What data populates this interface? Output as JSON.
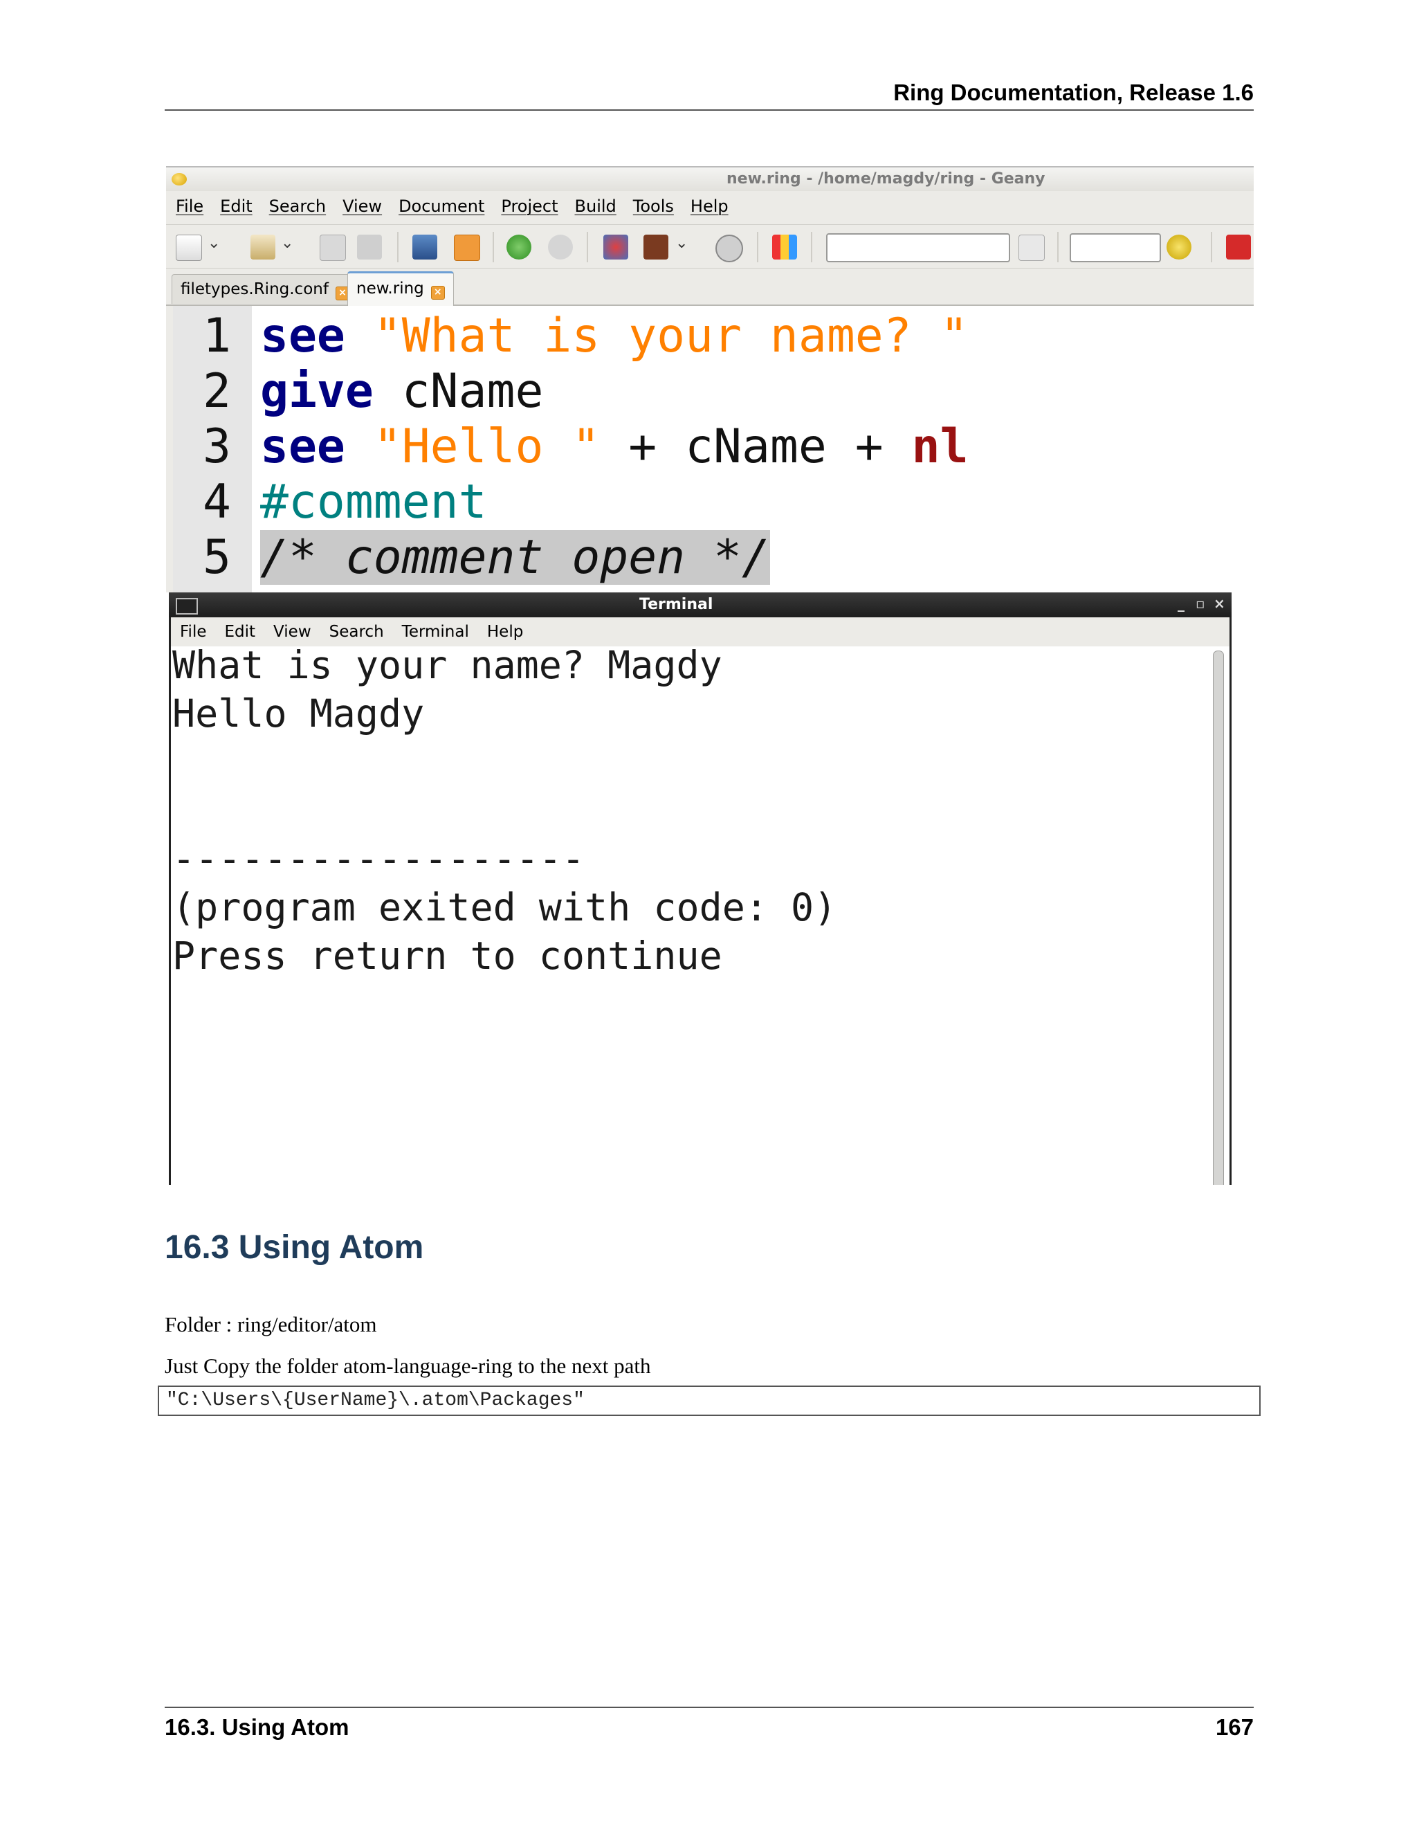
{
  "page": {
    "header": "Ring Documentation, Release 1.6",
    "footer_section": "16.3.  Using Atom",
    "footer_page": "167"
  },
  "geany": {
    "title": "new.ring - /home/magdy/ring - Geany",
    "menu": [
      "File",
      "Edit",
      "Search",
      "View",
      "Document",
      "Project",
      "Build",
      "Tools",
      "Help"
    ],
    "tabs": [
      "filetypes.Ring.conf",
      "new.ring"
    ],
    "active_tab": "new.ring",
    "code": [
      {
        "num": "1",
        "parts": [
          [
            "kw",
            "see"
          ],
          [
            "id",
            " "
          ],
          [
            "str",
            "\"What is your name? \""
          ]
        ]
      },
      {
        "num": "2",
        "parts": [
          [
            "kw",
            "give"
          ],
          [
            "id",
            " cName"
          ]
        ]
      },
      {
        "num": "3",
        "parts": [
          [
            "kw",
            "see"
          ],
          [
            "id",
            " "
          ],
          [
            "str",
            "\"Hello \""
          ],
          [
            "id",
            " + cName + "
          ],
          [
            "nl",
            "nl"
          ]
        ]
      },
      {
        "num": "4",
        "parts": [
          [
            "cmt",
            "#comment"
          ]
        ]
      },
      {
        "num": "5",
        "parts": [
          [
            "cmt-open",
            "/* comment open */"
          ]
        ]
      }
    ]
  },
  "terminal": {
    "title": "Terminal",
    "menu": [
      "File",
      "Edit",
      "View",
      "Search",
      "Terminal",
      "Help"
    ],
    "lines": [
      "What is your name? Magdy",
      "Hello Magdy",
      "",
      "",
      "------------------",
      "(program exited with code: 0)",
      "Press return to continue"
    ]
  },
  "section": {
    "title": "16.3  Using Atom",
    "para1": "Folder : ring/editor/atom",
    "para2": "Just Copy the folder atom-language-ring to the next path",
    "code": "\"C:\\Users\\{UserName}\\.atom\\Packages\""
  },
  "colors": {
    "keyword": "#000080",
    "string": "#ff8000",
    "comment": "#008080",
    "nl_keyword": "#991111",
    "section_title": "#1f3c5a"
  }
}
